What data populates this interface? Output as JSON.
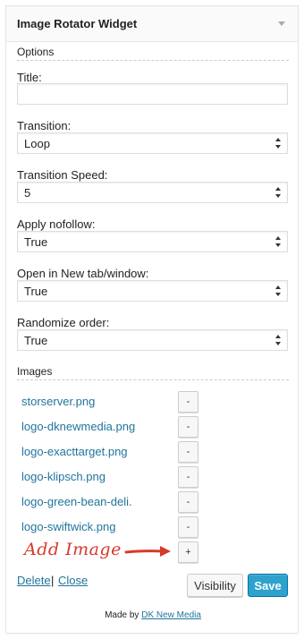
{
  "widget": {
    "title": "Image Rotator Widget",
    "toggle_icon": "triangle-down"
  },
  "options": {
    "heading": "Options",
    "title_label": "Title:",
    "title_value": "",
    "transition_label": "Transition:",
    "transition_value": "Loop",
    "speed_label": "Transition Speed:",
    "speed_value": "5",
    "nofollow_label": "Apply nofollow:",
    "nofollow_value": "True",
    "newtab_label": "Open in New tab/window:",
    "newtab_value": "True",
    "randomize_label": "Randomize order:",
    "randomize_value": "True"
  },
  "images": {
    "heading": "Images",
    "items": [
      "storserver.png",
      "logo-dknewmedia.png",
      "logo-exacttarget.png",
      "logo-klipsch.png",
      "logo-green-bean-deli.",
      "logo-swiftwick.png"
    ],
    "remove_label": "-",
    "add_label": "+",
    "annotation": "Add Image"
  },
  "footer": {
    "delete_label": "Delete",
    "separator": "|",
    "close_label": "Close",
    "visibility_label": "Visibility",
    "save_label": "Save",
    "made_by_prefix": "Made by",
    "made_by_link": "DK New Media"
  },
  "colors": {
    "link": "#21759b",
    "primary_button": "#2ea2cc",
    "annotation": "#d63a2b"
  }
}
